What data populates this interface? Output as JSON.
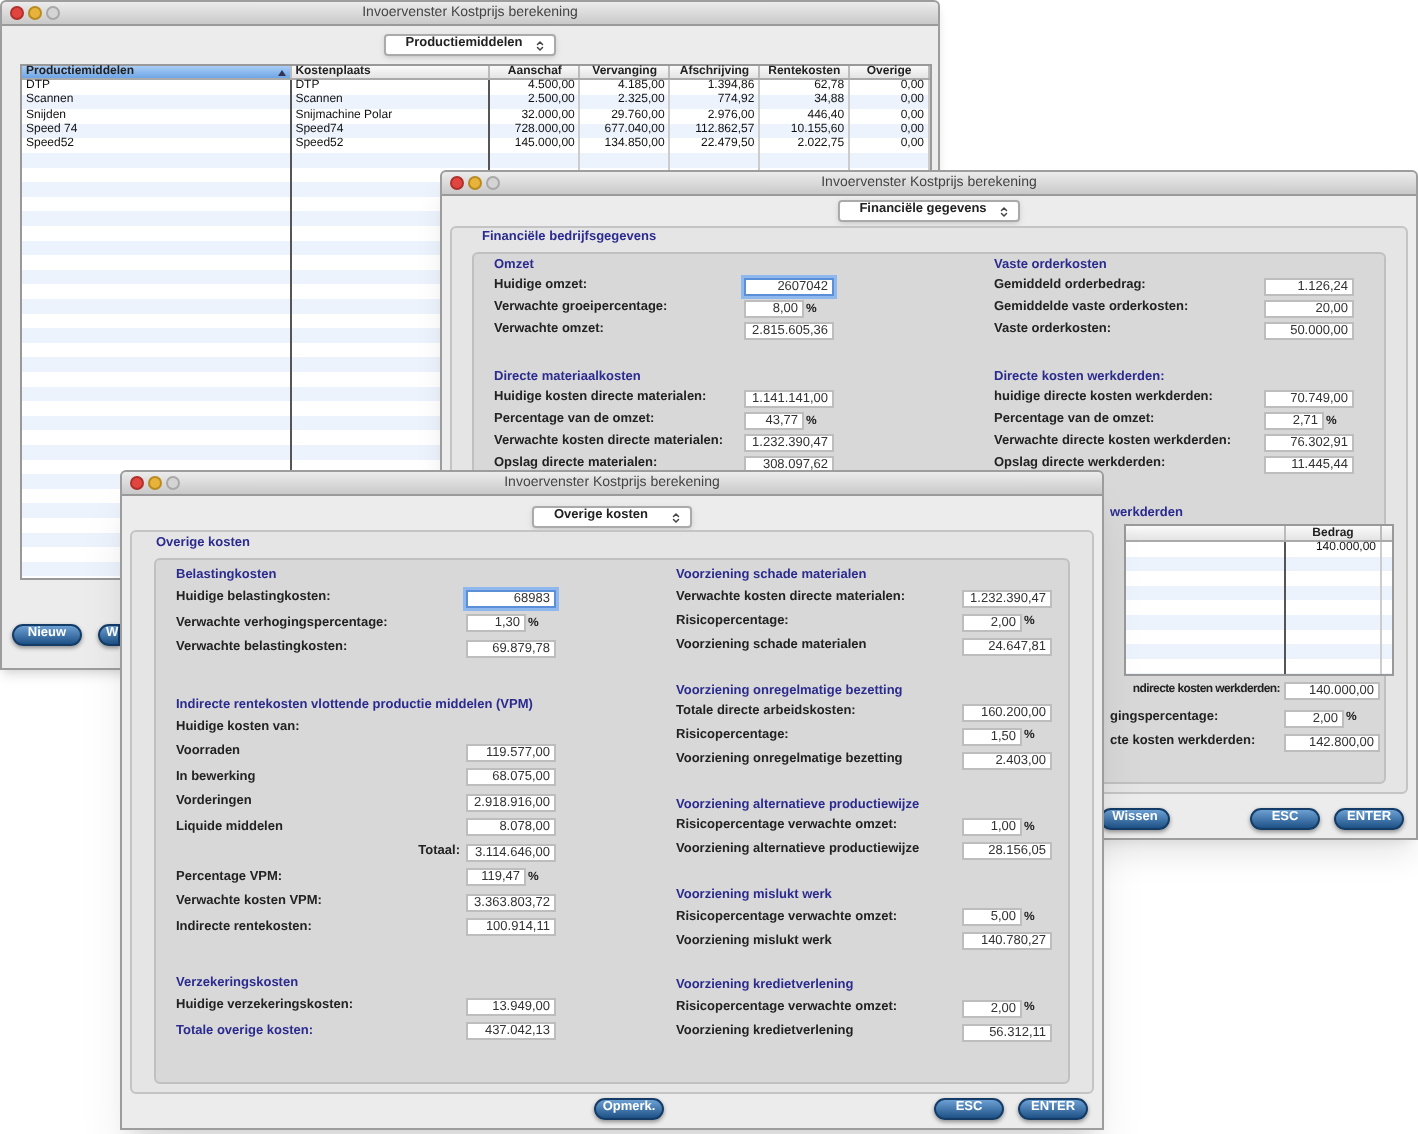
{
  "product_window": {
    "title": "Invoervenster Kostprijs berekening",
    "selector": "Productiemiddelen",
    "table": {
      "columns": [
        {
          "label": "Productiemiddelen",
          "kind": "text",
          "selected": true
        },
        {
          "label": "Kostenplaats",
          "kind": "text",
          "selected": false
        },
        {
          "label": "Aanschaf",
          "kind": "number",
          "selected": false
        },
        {
          "label": "Vervanging",
          "kind": "number",
          "selected": false
        },
        {
          "label": "Afschrijving",
          "kind": "number",
          "selected": false
        },
        {
          "label": "Rentekosten",
          "kind": "number",
          "selected": false
        },
        {
          "label": "Overige",
          "kind": "number",
          "selected": false
        }
      ],
      "rows": [
        [
          "DTP",
          "DTP",
          "4.500,00",
          "4.185,00",
          "1.394,86",
          "62,78",
          "0,00"
        ],
        [
          "Scannen",
          "Scannen",
          "2.500,00",
          "2.325,00",
          "774,92",
          "34,88",
          "0,00"
        ],
        [
          "Snijden",
          "Snijmachine Polar",
          "32.000,00",
          "29.760,00",
          "2.976,00",
          "446,40",
          "0,00"
        ],
        [
          "Speed 74",
          "Speed74",
          "728.000,00",
          "677.040,00",
          "112.862,57",
          "10.155,60",
          "0,00"
        ],
        [
          "Speed52",
          "Speed52",
          "145.000,00",
          "134.850,00",
          "22.479,50",
          "2.022,75",
          "0,00"
        ]
      ]
    },
    "buttons": [
      "Nieuw",
      "W"
    ]
  },
  "financial_window": {
    "title": "Invoervenster Kostprijs berekening",
    "selector": "Financiële gegevens",
    "group_title": "Financiële bedrijfsgegevens",
    "columns": [
      [
        {
          "title": "Omzet",
          "rows": [
            {
              "kind": "field",
              "label": "Huidige omzet:",
              "value": "2607042",
              "focused": true
            },
            {
              "kind": "field",
              "label": "Verwachte groeipercentage:",
              "value": "8,00",
              "unit": "%",
              "focused": false
            },
            {
              "kind": "field",
              "label": "Verwachte omzet:",
              "value": "2.815.605,36",
              "focused": false
            }
          ]
        },
        {
          "title": "Directe materiaalkosten",
          "rows": [
            {
              "kind": "field",
              "label": "Huidige kosten directe materialen:",
              "value": "1.141.141,00",
              "focused": false
            },
            {
              "kind": "field",
              "label": "Percentage van de omzet:",
              "value": "43,77",
              "unit": "%",
              "focused": false
            },
            {
              "kind": "field",
              "label": "Verwachte kosten directe materialen:",
              "value": "1.232.390,47",
              "focused": false
            },
            {
              "kind": "field",
              "label": "Opslag directe materialen:",
              "value": "308.097,62",
              "focused": false
            }
          ]
        }
      ],
      [
        {
          "title": "Vaste orderkosten",
          "rows": [
            {
              "kind": "field",
              "label": "Gemiddeld orderbedrag:",
              "value": "1.126,24",
              "focused": false
            },
            {
              "kind": "field",
              "label": "Gemiddelde vaste orderkosten:",
              "value": "20,00",
              "focused": false
            },
            {
              "kind": "field",
              "label": "Vaste orderkosten:",
              "value": "50.000,00",
              "focused": false
            }
          ]
        },
        {
          "title": "Directe kosten werkderden:",
          "rows": [
            {
              "kind": "field",
              "label": "huidige directe kosten werkderden:",
              "value": "70.749,00",
              "focused": false
            },
            {
              "kind": "field",
              "label": "Percentage van de omzet:",
              "value": "2,71",
              "unit": "%",
              "focused": false
            },
            {
              "kind": "field",
              "label": "Verwachte directe kosten werkderden:",
              "value": "76.302,91",
              "focused": false
            },
            {
              "kind": "field",
              "label": "Opslag directe werkderden:",
              "value": "11.445,44",
              "focused": false
            }
          ]
        }
      ]
    ],
    "indirect_costs": {
      "title": "werkderden",
      "columns": [
        "Bedrag"
      ],
      "rows": [
        [
          "140.000,00"
        ]
      ],
      "total_label": "ndirecte kosten werkderden:",
      "total": "140.000,00",
      "rows_after": [
        {
          "kind": "field",
          "label": "gingspercentage:",
          "value": "2,00",
          "unit": "%",
          "focused": false
        },
        {
          "kind": "field",
          "label": "cte kosten werkderden:",
          "value": "142.800,00",
          "focused": false
        }
      ]
    },
    "buttons": [
      "Wissen",
      "ESC",
      "ENTER"
    ]
  },
  "other_costs_window": {
    "title": "Invoervenster Kostprijs berekening",
    "selector": "Overige kosten",
    "group_title": "Overige kosten",
    "columns": [
      [
        {
          "title": "Belastingkosten",
          "rows": [
            {
              "kind": "field",
              "label": "Huidige belastingkosten:",
              "value": "68983",
              "focused": true
            },
            {
              "kind": "field",
              "label": "Verwachte verhogingspercentage:",
              "value": "1,30",
              "unit": "%",
              "focused": false
            },
            {
              "kind": "field",
              "label": "Verwachte belastingkosten:",
              "value": "69.879,78",
              "focused": false
            }
          ]
        },
        {
          "title": "Indirecte rentekosten vlottende productie middelen (VPM)",
          "rows": [
            {
              "kind": "label",
              "label": "Huidige kosten van:"
            },
            {
              "kind": "field",
              "label": "Voorraden",
              "value": "119.577,00",
              "focused": false
            },
            {
              "kind": "field",
              "label": "In bewerking",
              "value": "68.075,00",
              "focused": false
            },
            {
              "kind": "field",
              "label": "Vorderingen",
              "value": "2.918.916,00",
              "focused": false
            },
            {
              "kind": "field",
              "label": "Liquide middelen",
              "value": "8.078,00",
              "focused": false
            },
            {
              "kind": "total",
              "label": "Totaal:",
              "value": "3.114.646,00",
              "focused": false
            },
            {
              "kind": "field",
              "label": "Percentage VPM:",
              "value": "119,47",
              "unit": "%",
              "focused": false
            },
            {
              "kind": "field",
              "label": "Verwachte kosten VPM:",
              "value": "3.363.803,72",
              "focused": false
            },
            {
              "kind": "field",
              "label": "Indirecte rentekosten:",
              "value": "100.914,11",
              "focused": false
            }
          ]
        },
        {
          "title": "Verzekeringskosten",
          "rows": [
            {
              "kind": "field",
              "label": "Huidige verzekeringskosten:",
              "value": "13.949,00",
              "focused": false
            },
            {
              "kind": "summary",
              "label": "Totale overige kosten:",
              "value": "437.042,13",
              "focused": false
            }
          ]
        }
      ],
      [
        {
          "title": "Voorziening schade materialen",
          "rows": [
            {
              "kind": "field",
              "label": "Verwachte kosten directe materialen:",
              "value": "1.232.390,47",
              "focused": false
            },
            {
              "kind": "field",
              "label": "Risicopercentage:",
              "value": "2,00",
              "unit": "%",
              "focused": false
            },
            {
              "kind": "field",
              "label": "Voorziening schade materialen",
              "value": "24.647,81",
              "focused": false
            }
          ]
        },
        {
          "title": "Voorziening onregelmatige bezetting",
          "rows": [
            {
              "kind": "field",
              "label": "Totale directe arbeidskosten:",
              "value": "160.200,00",
              "focused": false
            },
            {
              "kind": "field",
              "label": "Risicopercentage:",
              "value": "1,50",
              "unit": "%",
              "focused": false
            },
            {
              "kind": "field",
              "label": "Voorziening onregelmatige bezetting",
              "value": "2.403,00",
              "focused": false
            }
          ]
        },
        {
          "title": "Voorziening alternatieve productiewijze",
          "rows": [
            {
              "kind": "field",
              "label": "Risicopercentage verwachte omzet:",
              "value": "1,00",
              "unit": "%",
              "focused": false
            },
            {
              "kind": "field",
              "label": "Voorziening alternatieve productiewijze",
              "value": "28.156,05",
              "focused": false
            }
          ]
        },
        {
          "title": "Voorziening mislukt werk",
          "rows": [
            {
              "kind": "field",
              "label": "Risicopercentage verwachte omzet:",
              "value": "5,00",
              "unit": "%",
              "focused": false
            },
            {
              "kind": "field",
              "label": "Voorziening mislukt werk",
              "value": "140.780,27",
              "focused": false
            }
          ]
        },
        {
          "title": "Voorziening kredietverlening",
          "rows": [
            {
              "kind": "field",
              "label": "Risicopercentage verwachte omzet:",
              "value": "2,00",
              "unit": "%",
              "focused": false
            },
            {
              "kind": "field",
              "label": "Voorziening kredietverlening",
              "value": "56.312,11",
              "focused": false
            }
          ]
        }
      ]
    ],
    "buttons": [
      "Opmerk.",
      "ESC",
      "ENTER"
    ]
  }
}
